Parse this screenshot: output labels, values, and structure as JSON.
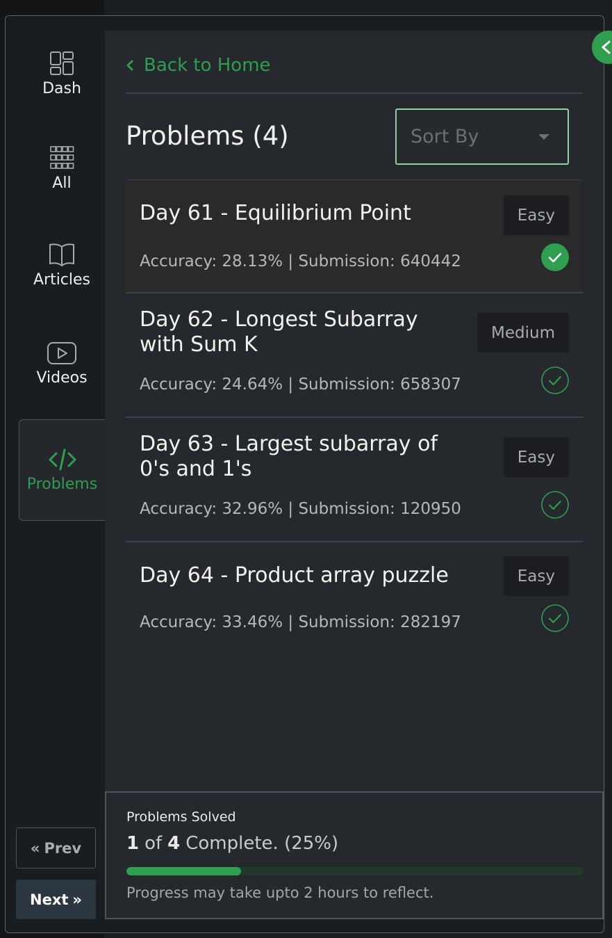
{
  "sidebar": {
    "items": [
      {
        "label": "Dash",
        "icon": "dashboard-icon"
      },
      {
        "label": "All",
        "icon": "grid-icon"
      },
      {
        "label": "Articles",
        "icon": "book-icon"
      },
      {
        "label": "Videos",
        "icon": "play-icon"
      },
      {
        "label": "Problems",
        "icon": "code-icon",
        "active": true
      }
    ],
    "prev_label": "Prev",
    "next_label": "Next"
  },
  "panel": {
    "back_label": "Back to Home",
    "title": "Problems (4)",
    "sort_placeholder": "Sort By"
  },
  "problems": [
    {
      "name": "Day 61 - Equilibrium Point",
      "meta": "Accuracy: 28.13% | Submission: 640442",
      "difficulty": "Easy",
      "status": "solved"
    },
    {
      "name": "Day 62 - Longest Subarray with Sum K",
      "meta": "Accuracy: 24.64% | Submission: 658307",
      "difficulty": "Medium",
      "status": "unsolved"
    },
    {
      "name": "Day 63 - Largest subarray of 0's and 1's",
      "meta": "Accuracy: 32.96% | Submission: 120950",
      "difficulty": "Easy",
      "status": "unsolved"
    },
    {
      "name": "Day 64 - Product array puzzle",
      "meta": "Accuracy: 33.46% | Submission: 282197",
      "difficulty": "Easy",
      "status": "unsolved"
    }
  ],
  "progress": {
    "caption": "Problems Solved",
    "solved": "1",
    "of_word": "of",
    "total": "4",
    "complete_text": "Complete. (25%)",
    "fraction": 0.25,
    "note": "Progress may take upto 2 hours to reflect."
  },
  "colors": {
    "accent": "#2f9e4f",
    "panel_bg": "#25292d",
    "sidebar_bg": "#1a1d20"
  }
}
